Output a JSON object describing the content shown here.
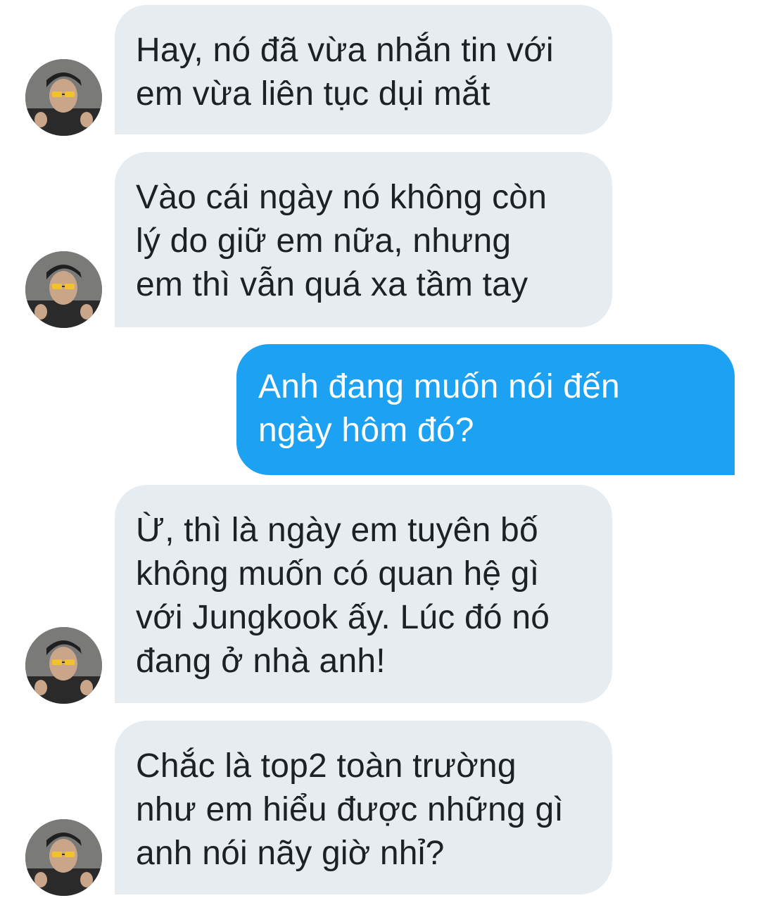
{
  "conversation": {
    "messages": [
      {
        "direction": "incoming",
        "text": "Hay, nó đã vừa nhắn tin với\nem vừa liên tục dụi mắt"
      },
      {
        "direction": "incoming",
        "text": "Vào cái ngày nó không còn\nlý do giữ em nữa, nhưng\nem thì vẫn quá xa tầm tay"
      },
      {
        "direction": "outgoing",
        "text": "Anh đang muốn nói đến\nngày hôm đó?"
      },
      {
        "direction": "incoming",
        "text": "Ừ, thì là ngày em tuyên bố\nkhông muốn có quan hệ gì\nvới Jungkook ấy. Lúc đó nó\nđang ở nhà anh!"
      },
      {
        "direction": "incoming",
        "text": "Chắc là top2 toàn trường\nnhư em hiểu được những gì\nanh nói nãy giờ nhỉ?"
      }
    ]
  },
  "colors": {
    "incoming_bubble": "#e6ecf0",
    "incoming_text": "#1c2126",
    "outgoing_bubble": "#1da1f2",
    "outgoing_text": "#ffffff"
  },
  "icons": {
    "avatar": "profile-photo-avatar"
  }
}
